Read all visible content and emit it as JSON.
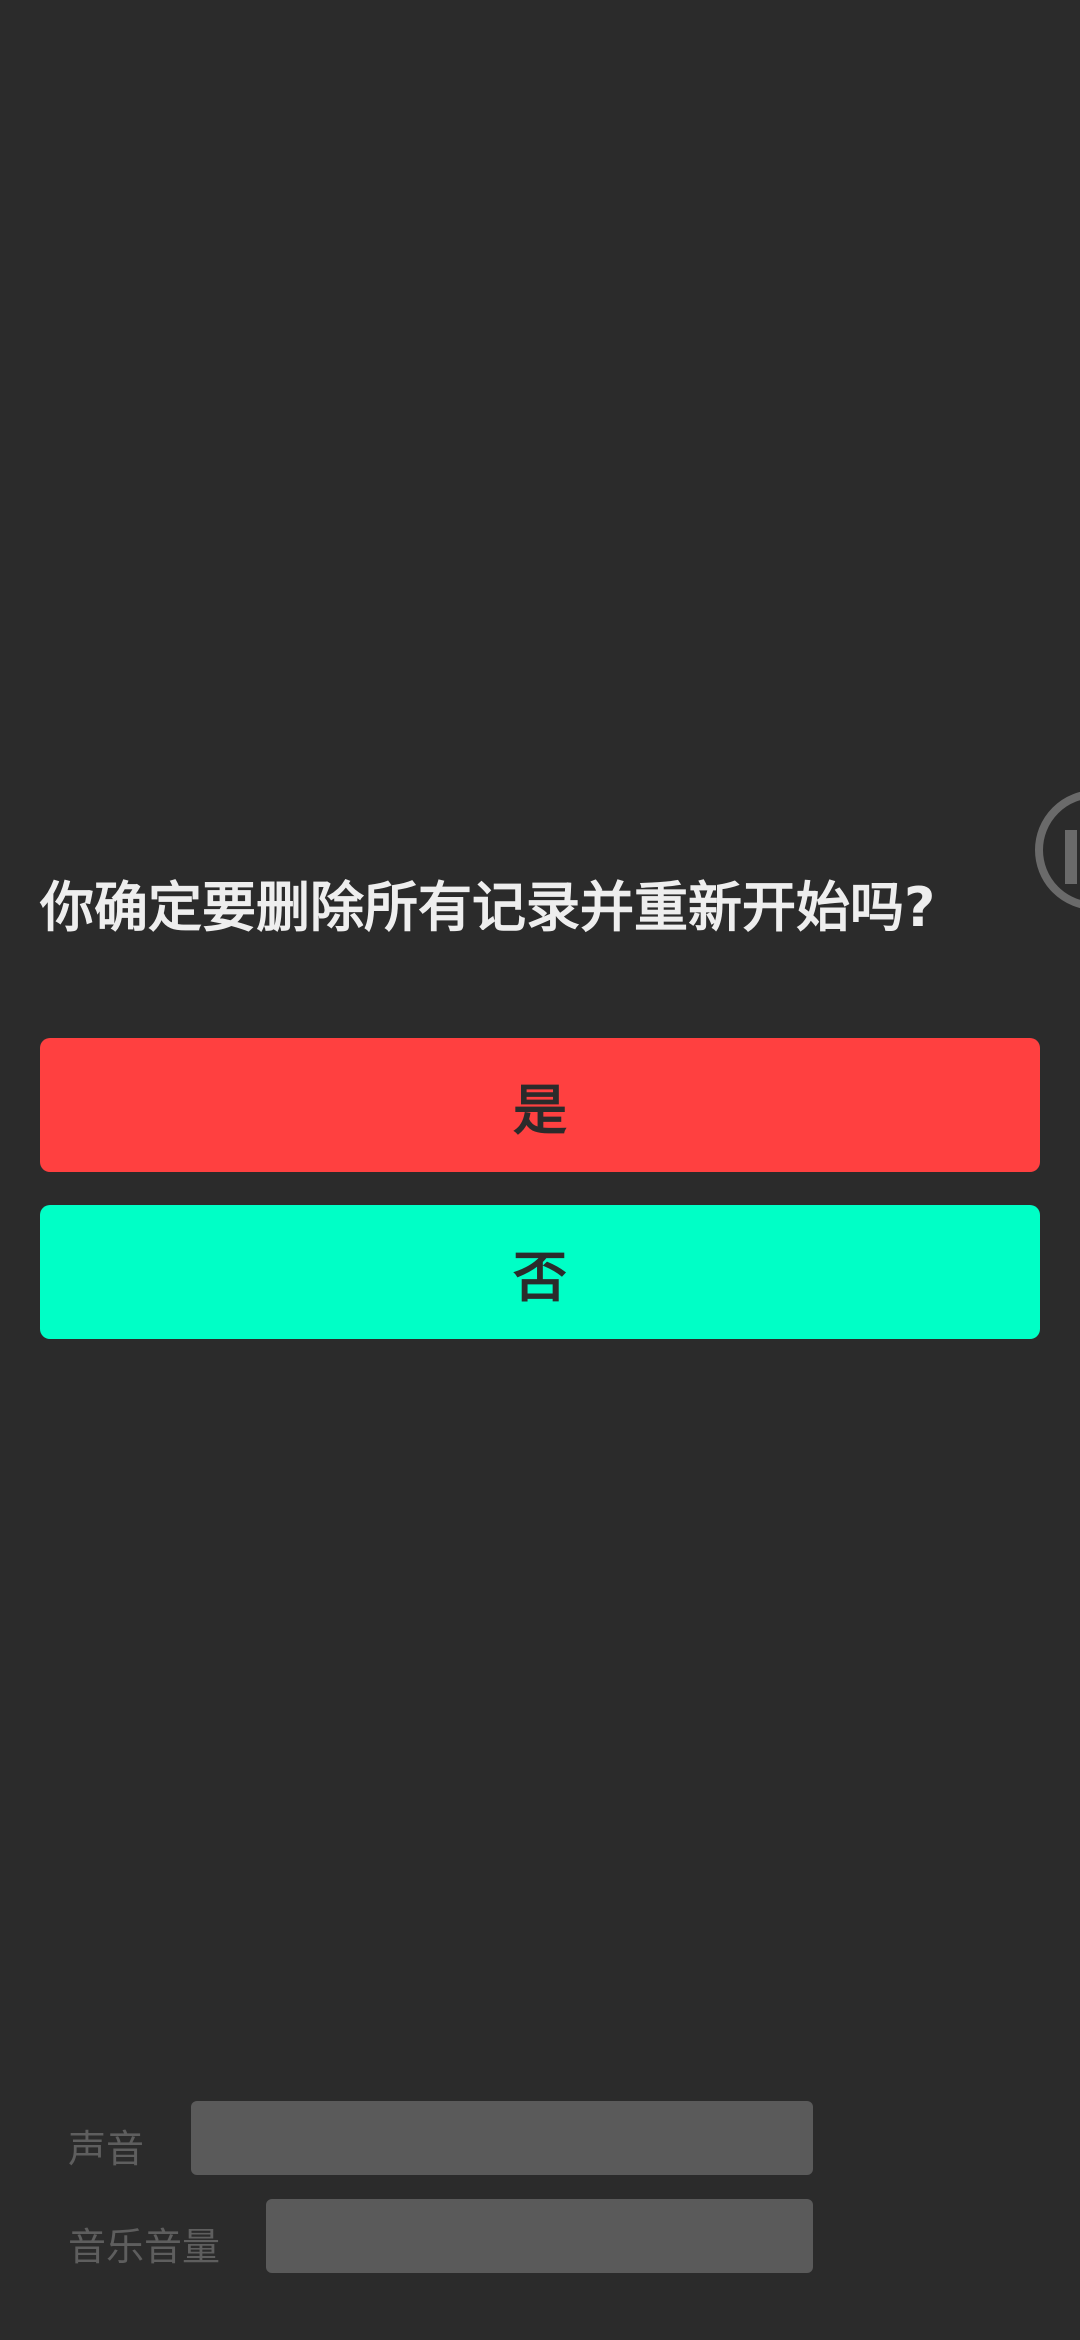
{
  "dialog": {
    "question": "你确定要删除所有记录并重新开始吗?",
    "yes_label": "是",
    "no_label": "否",
    "colors": {
      "yes": "#ff4040",
      "no": "#00ffc6",
      "background": "#2b2b2b"
    }
  },
  "settings": {
    "sound_label": "声音",
    "music_volume_label": "音乐音量"
  },
  "icons": {
    "edge_control": "circle-button-icon"
  }
}
